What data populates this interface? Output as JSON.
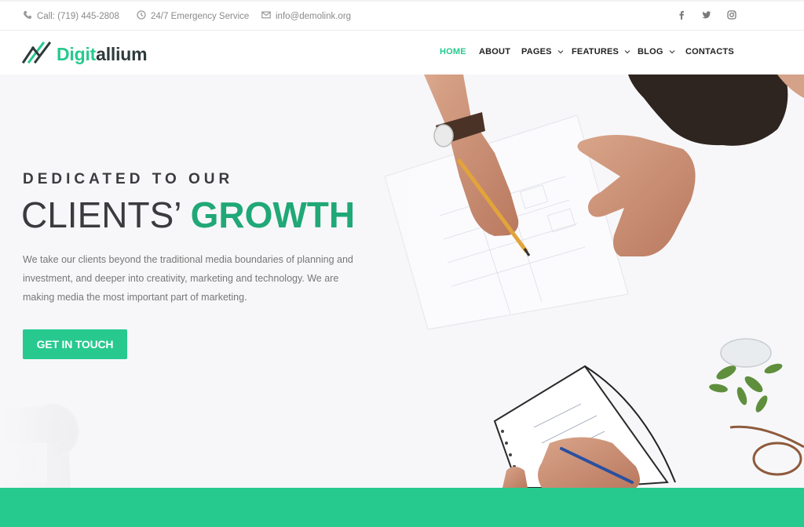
{
  "topbar": {
    "phone": "Call: (719) 445-2808",
    "service": "24/7 Emergency Service",
    "email": "info@demolink.org",
    "social_icons": [
      "facebook-icon",
      "twitter-icon",
      "instagram-icon"
    ]
  },
  "header": {
    "logo_part1": "Digit",
    "logo_part2": "allium",
    "nav": [
      {
        "label": "HOME",
        "active": true,
        "dropdown": false
      },
      {
        "label": "ABOUT",
        "active": false,
        "dropdown": false
      },
      {
        "label": "PAGES",
        "active": false,
        "dropdown": true
      },
      {
        "label": "FEATURES",
        "active": false,
        "dropdown": true
      },
      {
        "label": "BLOG",
        "active": false,
        "dropdown": true
      },
      {
        "label": "CONTACTS",
        "active": false,
        "dropdown": false
      }
    ]
  },
  "hero": {
    "eyebrow": "DEDICATED TO OUR",
    "headline_light": "CLIENTS’",
    "headline_bold": "GROWTH",
    "description": "We take our clients beyond the traditional media boundaries of planning and investment, and deeper into creativity, marketing and technology. We are making media the most important part of marketing.",
    "cta_label": "GET IN TOUCH"
  },
  "colors": {
    "accent": "#27c98f",
    "accent_dark": "#20a877",
    "text_dark": "#3b3b3f",
    "band": "#26c98e"
  }
}
